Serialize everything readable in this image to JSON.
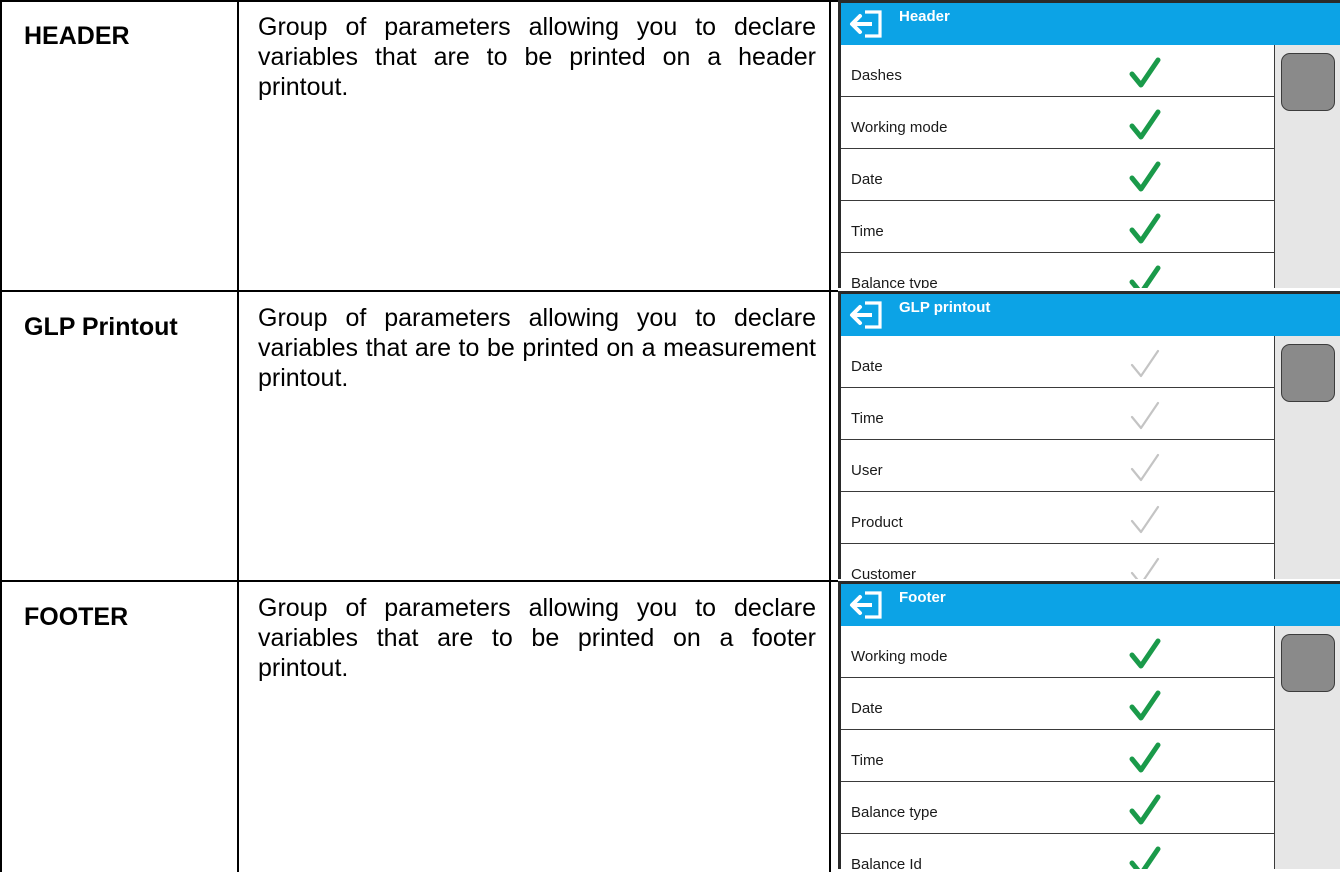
{
  "rows": [
    {
      "label": "HEADER",
      "description": "Group of parameters allowing you to declare variables that are to be printed on a header printout.",
      "screen": {
        "title": "Header",
        "check_style": "enabled",
        "items": [
          "Dashes",
          "Working mode",
          "Date",
          "Time",
          "Balance type"
        ]
      }
    },
    {
      "label": "GLP Printout",
      "description": "Group of parameters allowing you to declare variables that are to be printed on a measurement printout.",
      "screen": {
        "title": "GLP printout",
        "check_style": "disabled",
        "items": [
          "Date",
          "Time",
          "User",
          "Product",
          "Customer"
        ]
      }
    },
    {
      "label": "FOOTER",
      "description": "Group of parameters allowing you to declare variables that are to be printed on a footer printout.",
      "screen": {
        "title": "Footer",
        "check_style": "enabled",
        "items": [
          "Working mode",
          "Date",
          "Time",
          "Balance type",
          "Balance Id"
        ]
      }
    }
  ],
  "colors": {
    "titlebar": "#0ca3e6",
    "check_enabled": "#1a9a4a",
    "check_disabled": "#c4c4c4",
    "scroll_thumb": "#8a8a8a"
  },
  "icons": {
    "back": "back-arrow-icon",
    "check": "checkmark-icon"
  }
}
